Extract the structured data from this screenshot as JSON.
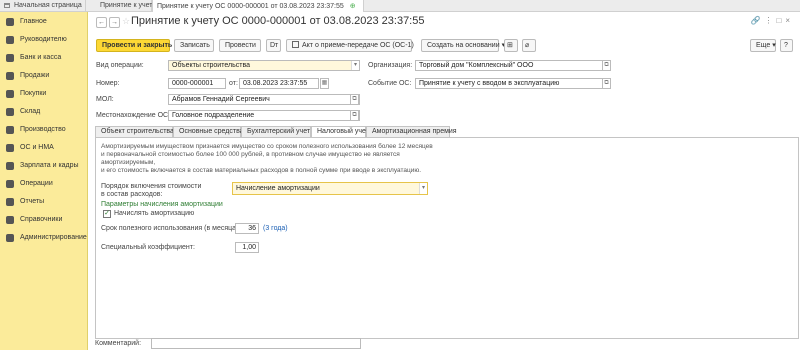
{
  "tabs": [
    {
      "label": "Начальная страница",
      "active": false
    },
    {
      "label": "Принятие к учету ОС",
      "active": false
    },
    {
      "label": "Принятие к учету ОС 0000-000001 от 03.08.2023 23:37:55",
      "active": true
    }
  ],
  "sidebar": {
    "items": [
      {
        "label": "Главное",
        "icon": "menu-icon"
      },
      {
        "label": "Руководителю",
        "icon": "chart-icon"
      },
      {
        "label": "Банк и касса",
        "icon": "bank-icon"
      },
      {
        "label": "Продажи",
        "icon": "cart-icon"
      },
      {
        "label": "Покупки",
        "icon": "basket-icon"
      },
      {
        "label": "Склад",
        "icon": "warehouse-icon"
      },
      {
        "label": "Производство",
        "icon": "factory-icon"
      },
      {
        "label": "ОС и НМА",
        "icon": "assets-icon"
      },
      {
        "label": "Зарплата и кадры",
        "icon": "people-icon"
      },
      {
        "label": "Операции",
        "icon": "operations-icon"
      },
      {
        "label": "Отчеты",
        "icon": "reports-icon"
      },
      {
        "label": "Справочники",
        "icon": "book-icon"
      },
      {
        "label": "Администрирование",
        "icon": "gear-icon"
      }
    ]
  },
  "header": {
    "title": "Принятие к учету ОС 0000-000001 от 03.08.2023 23:37:55"
  },
  "toolbar": {
    "post_close": "Провести и закрыть",
    "save": "Записать",
    "post": "Провести",
    "act": "Акт о приеме-передаче ОС (ОС-1)",
    "create_based": "Создать на основании",
    "more": "Еще",
    "help": "?"
  },
  "form": {
    "operation_label": "Вид операции:",
    "operation_value": "Объекты строительства",
    "number_label": "Номер:",
    "number_value": "0000-000001",
    "date_label": "от:",
    "date_value": "03.08.2023 23:37:55",
    "mol_label": "МОЛ:",
    "mol_value": "Абрамов Геннадий Сергеевич",
    "location_label": "Местонахождение ОС:",
    "location_value": "Головное подразделение",
    "org_label": "Организация:",
    "org_value": "Торговый дом \"Комплексный\" ООО",
    "event_label": "Событие ОС:",
    "event_value": "Принятие к учету с вводом в эксплуатацию"
  },
  "form_tabs": [
    {
      "label": "Объект строительства",
      "active": false
    },
    {
      "label": "Основные средства",
      "active": false
    },
    {
      "label": "Бухгалтерский учет",
      "active": false
    },
    {
      "label": "Налоговый учет",
      "active": true
    },
    {
      "label": "Амортизационная премия",
      "active": false
    }
  ],
  "tax": {
    "note_lines": [
      "Амортизируемым имуществом признается имущество со сроком полезного использования более 12 месяцев",
      "и первоначальной стоимостью более 100 000 рублей, в противном случае имущество не является амортизируемым,",
      "и его стоимость включается в состав материальных расходов в полной сумме при вводе в эксплуатацию."
    ],
    "order_label_1": "Порядок включения стоимости",
    "order_label_2": "в состав расходов:",
    "order_value": "Начисление амортизации",
    "section_title": "Параметры начисления амортизации",
    "accrue_label": "Начислять амортизацию",
    "accrue_checked": true,
    "life_label": "Срок полезного использования (в месяцах):",
    "life_value": "36",
    "life_hint": "(3 года)",
    "coef_label": "Специальный коэффициент:",
    "coef_value": "1,00"
  },
  "footer": {
    "comment_label": "Комментарий:",
    "comment_value": ""
  },
  "colors": {
    "sidebar_bg": "#fbeb9a",
    "primary_button": "#fdd835",
    "section_green": "#2e7d32",
    "link_blue": "#1a5fb4"
  }
}
